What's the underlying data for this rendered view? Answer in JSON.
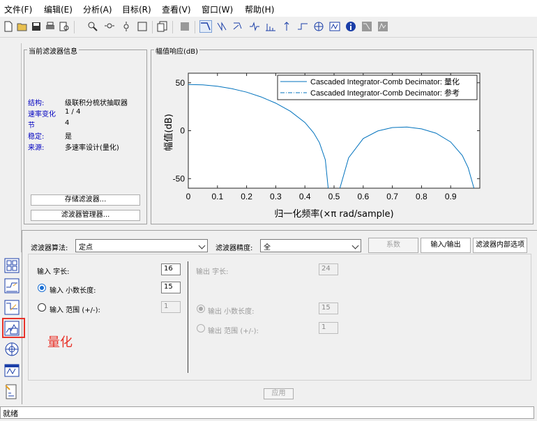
{
  "menu": [
    "文件(F)",
    "编辑(E)",
    "分析(A)",
    "目标(R)",
    "查看(V)",
    "窗口(W)",
    "帮助(H)"
  ],
  "toolbar_icons": [
    "new-icon",
    "open-icon",
    "save-icon",
    "print-icon",
    "print-preview-icon",
    "zoom-in-icon",
    "zoom-x-icon",
    "zoom-y-icon",
    "full-view-icon",
    "new-figure-icon",
    "fdatool-icon",
    "magnitude-response-icon",
    "phase-response-icon",
    "magnitude-phase-icon",
    "group-delay-icon",
    "impulse-response-icon",
    "step-response-icon",
    "pole-zero-icon",
    "filter-coefficients-icon",
    "filter-info-icon",
    "magnitude-estimate-icon",
    "noise-psd-icon"
  ],
  "filter_info": {
    "title": "当前滤波器信息",
    "rows": [
      {
        "key": "结构:",
        "value": "级联积分梳状抽取器"
      },
      {
        "key": "速率变化",
        "value": "1 / 4"
      },
      {
        "key": "节",
        "value": "4"
      },
      {
        "key": "稳定:",
        "value": "是"
      },
      {
        "key": "来源:",
        "value": "多速率设计(量化)"
      }
    ],
    "store_button": "存储滤波器...",
    "manager_button": "滤波器管理器..."
  },
  "plot": {
    "title": "幅值响应(dB)",
    "ylabel": "幅值(dB)",
    "xlabel": "归一化频率(×π rad/sample)"
  },
  "chart_data": {
    "type": "line",
    "title": "幅值响应(dB)",
    "xlabel": "归一化频率(×π rad/sample)",
    "ylabel": "幅值(dB)",
    "xlim": [
      0,
      1
    ],
    "ylim": [
      -60,
      60
    ],
    "xticks": [
      "0",
      "0.1",
      "0.2",
      "0.3",
      "0.4",
      "0.5",
      "0.6",
      "0.7",
      "0.8",
      "0.9"
    ],
    "yticks": [
      "50",
      "0",
      "-50"
    ],
    "legend_position": "top-right",
    "series": [
      {
        "name": "Cascaded Integrator-Comb Decimator: 量化",
        "style": "solid",
        "color": "#0072bd",
        "x": [
          0,
          0.05,
          0.1,
          0.15,
          0.2,
          0.25,
          0.3,
          0.35,
          0.4,
          0.43,
          0.45,
          0.47,
          0.48,
          0.5,
          0.52,
          0.55,
          0.6,
          0.65,
          0.7,
          0.75,
          0.8,
          0.85,
          0.9,
          0.94,
          0.96,
          0.98
        ],
        "y": [
          48.2,
          47.8,
          46.3,
          43.8,
          40.2,
          35.2,
          28.7,
          20.3,
          8.6,
          -2.2,
          -12.6,
          -30.5,
          -60,
          -90,
          -60,
          -28.2,
          -8.2,
          -0.3,
          3.3,
          3.8,
          1.9,
          -2.6,
          -11.8,
          -25.8,
          -38.7,
          -60
        ]
      },
      {
        "name": "Cascaded Integrator-Comb Decimator: 参考",
        "style": "dashdot",
        "color": "#0072bd",
        "x": [],
        "y": []
      }
    ]
  },
  "quant": {
    "algo_label": "滤波器算法:",
    "algo_value": "定点",
    "precision_label": "滤波器精度:",
    "precision_value": "全",
    "tabs": [
      "系数",
      "输入/输出",
      "滤波器内部选项"
    ],
    "input_word_label": "输入 字长:",
    "input_word_value": "16",
    "input_frac_label": "输入 小数长度:",
    "input_frac_value": "15",
    "input_range_label": "输入 范围 (+/-):",
    "input_range_value": "1",
    "output_word_label": "输出 字长:",
    "output_word_value": "24",
    "output_frac_label": "输出 小数长度:",
    "output_frac_value": "15",
    "output_range_label": "输出 范围 (+/-):",
    "output_range_value": "1",
    "apply_button": "应用"
  },
  "annotation": {
    "text": "量化",
    "color": "#e8332a"
  },
  "side_icons": [
    "design-filter-icon",
    "transform-filter-icon",
    "pole-zero-editor-icon",
    "set-quantization-icon",
    "realize-model-icon",
    "import-filter-icon",
    "multirate-design-icon"
  ],
  "status": "就绪"
}
